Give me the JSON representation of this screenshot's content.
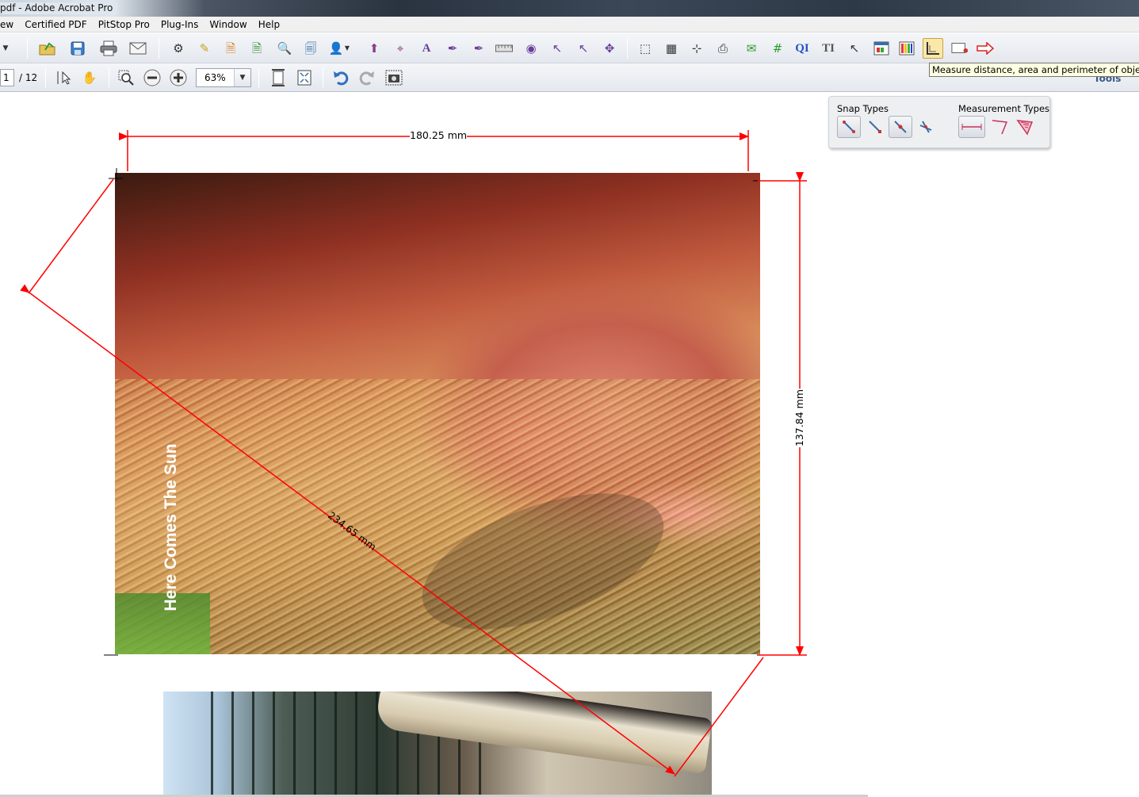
{
  "app": {
    "title": "pdf - Adobe Acrobat Pro"
  },
  "menu": {
    "items": [
      "ew",
      "Certified PDF",
      "PitStop Pro",
      "Plug-Ins",
      "Window",
      "Help"
    ]
  },
  "navigation": {
    "current_page": "1",
    "total_pages": "/ 12"
  },
  "zoom": {
    "value": "63%"
  },
  "tooltip": {
    "text": "Measure distance, area and perimeter of objects"
  },
  "tools_pane": {
    "label": "Tools"
  },
  "measure_panel": {
    "snap_types_label": "Snap Types",
    "measurement_types_label": "Measurement Types"
  },
  "measurements": {
    "width": "180.25 mm",
    "height": "137.84 mm",
    "diagonal": "234.65 mm"
  },
  "document": {
    "caption": "Here Comes The Sun"
  },
  "colors": {
    "measure_line": "#ff0000",
    "tooltip_bg": "#ffffe1",
    "selected_tool": "#fbe7a8"
  }
}
